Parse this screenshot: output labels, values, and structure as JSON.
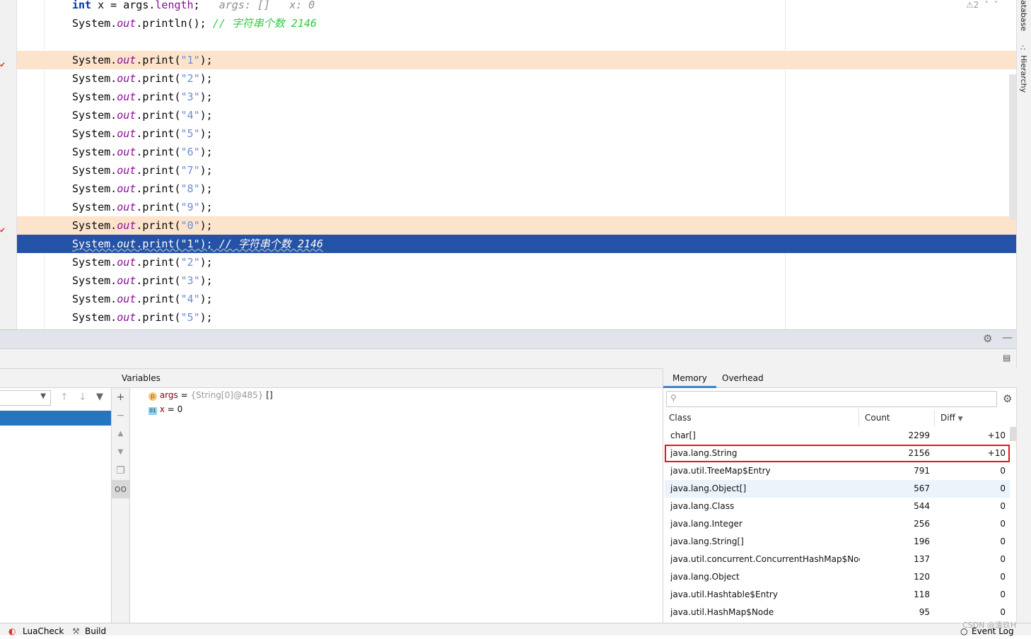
{
  "editor": {
    "line0": {
      "kw": "int",
      "code": " x = args.",
      "field": "length",
      "end": ";",
      "hint_args": "args: []",
      "hint_x": "x: 0"
    },
    "line1": {
      "pre": "System.",
      "field": "out",
      "mid": ".println();",
      "comment": "// 字符串个数 2146"
    },
    "print_lines": [
      {
        "arg": "\"1\"",
        "state": "breakpoint"
      },
      {
        "arg": "\"2\""
      },
      {
        "arg": "\"3\""
      },
      {
        "arg": "\"4\""
      },
      {
        "arg": "\"5\""
      },
      {
        "arg": "\"6\""
      },
      {
        "arg": "\"7\""
      },
      {
        "arg": "\"8\""
      },
      {
        "arg": "\"9\""
      },
      {
        "arg": "\"0\"",
        "state": "breakpoint"
      },
      {
        "arg": "\"1\"",
        "state": "current",
        "comment": "// 字符串个数 2146"
      },
      {
        "arg": "\"2\""
      },
      {
        "arg": "\"3\""
      },
      {
        "arg": "\"4\""
      },
      {
        "arg": "\"5\""
      }
    ],
    "warnings_count": "2"
  },
  "right_strip": {
    "database": "atabase",
    "hierarchy": "Hierarchy"
  },
  "debugger": {
    "variables_title": "Variables",
    "variables": [
      {
        "icon": "p",
        "name": "args",
        "value": " = ",
        "detail": "{String[0]@485}",
        "extra": " []"
      },
      {
        "icon": "01",
        "name": "x",
        "value": " = 0"
      }
    ]
  },
  "memory": {
    "tabs": [
      "Memory",
      "Overhead"
    ],
    "active_tab": "Memory",
    "search_placeholder": "",
    "columns": [
      "Class",
      "Count",
      "Diff"
    ],
    "rows": [
      {
        "class": "char[]",
        "count": "2299",
        "diff": "+10"
      },
      {
        "class": "java.lang.String",
        "count": "2156",
        "diff": "+10",
        "highlighted": true
      },
      {
        "class": "java.util.TreeMap$Entry",
        "count": "791",
        "diff": "0"
      },
      {
        "class": "java.lang.Object[]",
        "count": "567",
        "diff": "0"
      },
      {
        "class": "java.lang.Class",
        "count": "544",
        "diff": "0"
      },
      {
        "class": "java.lang.Integer",
        "count": "256",
        "diff": "0"
      },
      {
        "class": "java.lang.String[]",
        "count": "196",
        "diff": "0"
      },
      {
        "class": "java.util.concurrent.ConcurrentHashMap$Node",
        "count": "137",
        "diff": "0"
      },
      {
        "class": "java.lang.Object",
        "count": "120",
        "diff": "0"
      },
      {
        "class": "java.util.Hashtable$Entry",
        "count": "118",
        "diff": "0"
      },
      {
        "class": "java.util.HashMap$Node",
        "count": "95",
        "diff": "0"
      }
    ]
  },
  "status": {
    "luacheck": "LuaCheck",
    "build": "Build",
    "event_log": "Event Log",
    "watermark": "CSDN @清玖H"
  },
  "colors": {
    "current_line": "#2452a6",
    "breakpoint_line": "#fce3cc",
    "highlight_box": "#e8141b",
    "accent": "#4083c9"
  }
}
